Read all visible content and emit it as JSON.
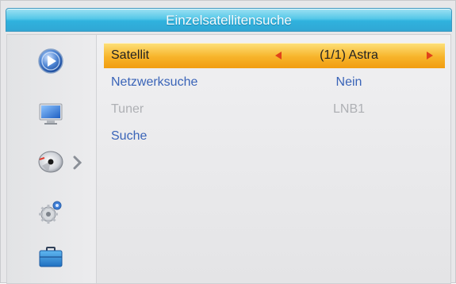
{
  "header": {
    "title": "Einzelsatellitensuche"
  },
  "sidebar": {
    "items": [
      {
        "icon": "play-icon",
        "selected": false
      },
      {
        "icon": "monitor-icon",
        "selected": false
      },
      {
        "icon": "satellite-dish-icon",
        "selected": true
      },
      {
        "icon": "gear-icon",
        "selected": false
      },
      {
        "icon": "toolbox-icon",
        "selected": false
      }
    ]
  },
  "menu": {
    "rows": [
      {
        "label": "Satellit",
        "value": "(1/1) Astra",
        "selected": true,
        "disabled": false
      },
      {
        "label": "Netzwerksuche",
        "value": "Nein",
        "selected": false,
        "disabled": false
      },
      {
        "label": "Tuner",
        "value": "LNB1",
        "selected": false,
        "disabled": true
      },
      {
        "label": "Suche",
        "value": "",
        "selected": false,
        "disabled": false
      }
    ]
  },
  "colors": {
    "title_bar": "#31a7d4",
    "highlight": "#f7b42b",
    "menu_text": "#3a64b8",
    "disabled_text": "#aeb0b4",
    "arrow": "#e0421a"
  }
}
